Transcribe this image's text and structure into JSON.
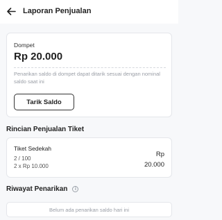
{
  "header": {
    "title": "Laporan Penjualan",
    "back_icon": "arrow-left-icon"
  },
  "wallet": {
    "label": "Dompet",
    "balance": "Rp 20.000",
    "note": "Penarikan saldo di dompet dapat ditarik sesuai dengan nominal saldo saat ini",
    "withdraw_label": "Tarik Saldo"
  },
  "ticket_section": {
    "title": "Rincian Penjualan Tiket",
    "items": [
      {
        "name": "Tiket Sedekah",
        "count": "2 / 100",
        "price": "2 x Rp 10.000",
        "total_currency": "Rp",
        "total_amount": "20.000"
      }
    ]
  },
  "withdraw_history": {
    "title": "Riwayat Penarikan",
    "info_icon": "info-icon",
    "empty_text": "Belum ada penarikan saldo hari ini"
  },
  "colors": {
    "background": "#f7f8fa",
    "card": "#ffffff",
    "border": "#e4e6ea",
    "muted_text": "#9a9ea6",
    "primary_text": "#222222"
  }
}
